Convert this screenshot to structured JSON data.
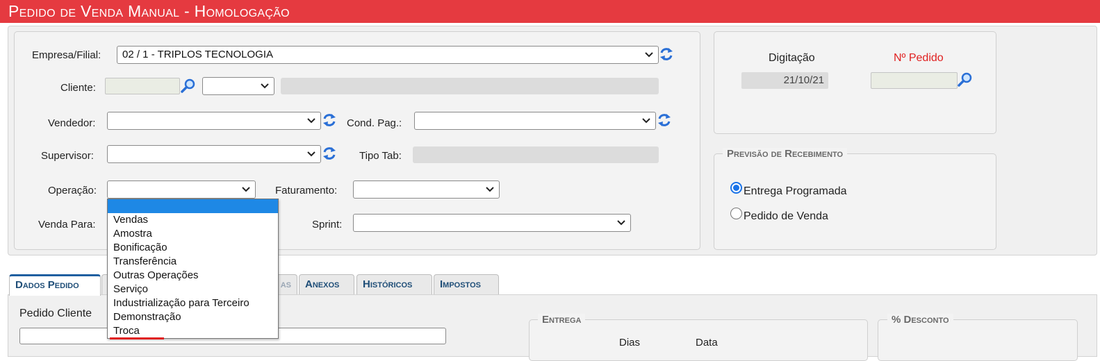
{
  "header": {
    "title": "Pedido de Venda Manual  - Homologação"
  },
  "form": {
    "empresa": {
      "label": "Empresa/Filial:",
      "value": "02 / 1 - TRIPLOS TECNOLOGIA"
    },
    "cliente": {
      "label": "Cliente:"
    },
    "vendedor": {
      "label": "Vendedor:"
    },
    "cond_pag": {
      "label": "Cond. Pag.:"
    },
    "supervisor": {
      "label": "Supervisor:"
    },
    "tipo_tab": {
      "label": "Tipo Tab:"
    },
    "operacao": {
      "label": "Operação:",
      "options": [
        "",
        "Vendas",
        "Amostra",
        "Bonificação",
        "Transferência",
        "Outras Operações",
        "Serviço",
        "Industrialização para Terceiro",
        "Demonstração",
        "Troca"
      ]
    },
    "faturamento": {
      "label": "Faturamento:"
    },
    "venda_para": {
      "label": "Venda Para:"
    },
    "sprint": {
      "label": "Sprint:"
    }
  },
  "info": {
    "digitacao_label": "Digitação",
    "digitacao_value": "21/10/21",
    "pedido_label": "Nº Pedido"
  },
  "previsao": {
    "legend": "Previsão de Recebimento",
    "options": [
      {
        "label": "Entrega Programada",
        "checked": true
      },
      {
        "label": "Pedido de Venda",
        "checked": false
      }
    ]
  },
  "tabs": [
    "Dados Pedido",
    "Anexos",
    "Históricos",
    "Impostos"
  ],
  "tabs_partial": "as",
  "dados": {
    "pedido_cliente_label": "Pedido Cliente",
    "entrega_legend": "Entrega",
    "dias_label": "Dias",
    "data_label": "Data",
    "desconto_legend": "% Desconto"
  },
  "colors": {
    "title_bg": "#e53a40",
    "accent": "#1e88e5",
    "tab_text": "#1f4e78",
    "pedido_label": "#e53a40"
  }
}
